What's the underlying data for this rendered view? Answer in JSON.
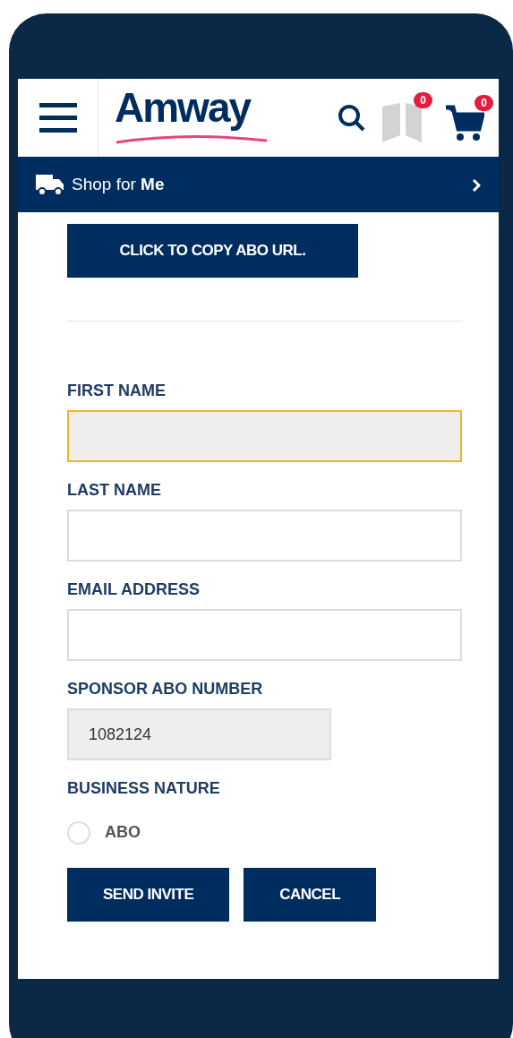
{
  "header": {
    "logo": "Amway",
    "shopping_list_badge": "0",
    "cart_badge": "0"
  },
  "nav_bar": {
    "label": "Shop for **Me**"
  },
  "copy_button": "CLICK TO COPY ABO URL.",
  "fields": [
    {
      "label": "FIRST NAME",
      "focused": true,
      "readonly": false
    },
    {
      "label": "LAST NAME",
      "focused": false,
      "readonly": false
    },
    {
      "label": "EMAIL ADDRESS",
      "focused": false,
      "readonly": false
    },
    {
      "label": "SPONSOR ABO NUMBER",
      "value": "1082124",
      "focused": false,
      "readonly": true
    }
  ],
  "business_nature": {
    "label": "BUSINESS NATURE",
    "options": [
      {
        "label": "ABO",
        "checked": false
      }
    ]
  },
  "buttons": [
    "SEND INVITE",
    "CANCEL"
  ]
}
